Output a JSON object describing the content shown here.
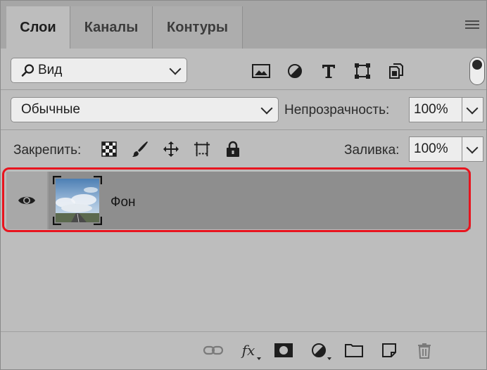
{
  "tabs": [
    {
      "label": "Слои",
      "active": true
    },
    {
      "label": "Каналы",
      "active": false
    },
    {
      "label": "Контуры",
      "active": false
    }
  ],
  "filter": {
    "selected": "Вид",
    "icons": [
      "image-filter-icon",
      "adjustment-filter-icon",
      "type-filter-icon",
      "shape-filter-icon",
      "smart-object-filter-icon"
    ]
  },
  "blend": {
    "mode": "Обычные",
    "opacity_label": "Непрозрачность:",
    "opacity_value": "100%"
  },
  "lock": {
    "label": "Закрепить:",
    "icons": [
      "lock-transparent-icon",
      "lock-pixels-icon",
      "lock-position-icon",
      "lock-artboard-icon",
      "lock-all-icon"
    ],
    "fill_label": "Заливка:",
    "fill_value": "100%"
  },
  "layers": [
    {
      "name": "Фон",
      "visible": true
    }
  ],
  "colors": {
    "panel": "#bdbdbd",
    "selected_layer": "#8e8e8e",
    "highlight": "#e8141e"
  },
  "bottom_icons": [
    "link-icon",
    "fx-icon",
    "mask-icon",
    "adjustment-layer-icon",
    "folder-icon",
    "new-layer-icon",
    "trash-icon"
  ]
}
